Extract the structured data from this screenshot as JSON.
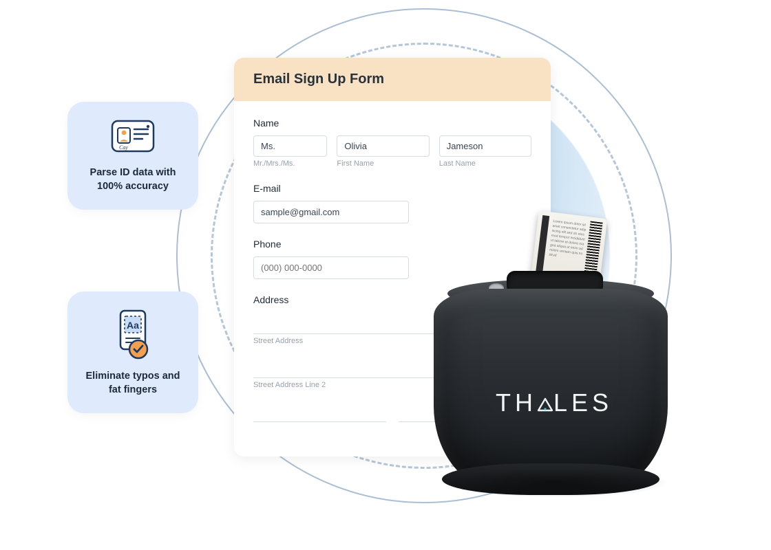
{
  "form": {
    "title": "Email Sign Up Form",
    "name": {
      "label": "Name",
      "title_value": "Ms.",
      "title_hint": "Mr./Mrs./Ms.",
      "first_value": "Olivia",
      "first_hint": "First Name",
      "last_value": "Jameson",
      "last_hint": "Last Name"
    },
    "email": {
      "label": "E-mail",
      "value": "sample@gmail.com"
    },
    "phone": {
      "label": "Phone",
      "placeholder": "(000) 000-0000"
    },
    "address": {
      "label": "Address",
      "street_hint": "Street Address",
      "street2_hint": "Street Address Line 2"
    }
  },
  "features": {
    "parse": "Parse ID data with 100% accuracy",
    "typos": "Eliminate typos and fat fingers"
  },
  "device": {
    "brand": "THALES"
  }
}
